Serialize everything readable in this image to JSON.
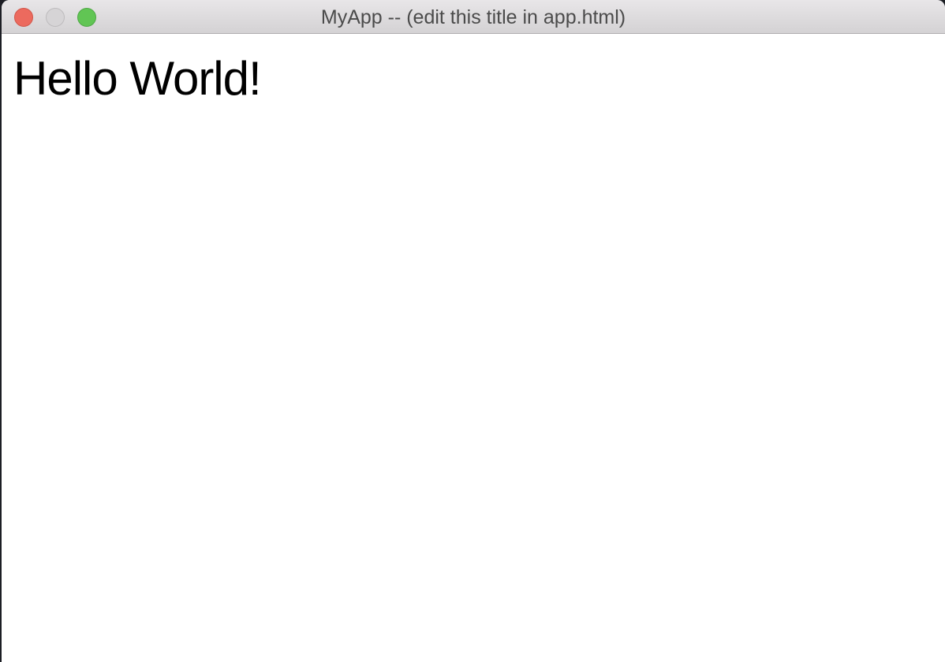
{
  "window": {
    "title": "MyApp -- (edit this title in app.html)",
    "buttons": {
      "close_color": "#ec6a5e",
      "minimize_color": "#d6d4d6",
      "maximize_color": "#61c554"
    }
  },
  "content": {
    "heading": "Hello World!"
  }
}
